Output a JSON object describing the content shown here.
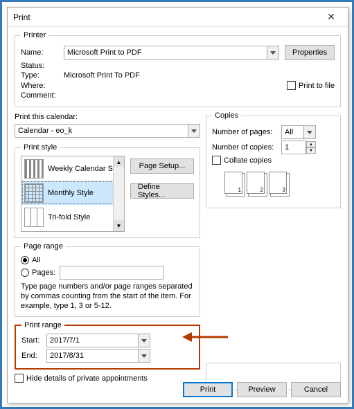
{
  "window": {
    "title": "Print",
    "close": "✕"
  },
  "printer": {
    "legend": "Printer",
    "name_label": "Name:",
    "name_value": "Microsoft Print to PDF",
    "properties_btn": "Properties",
    "status_label": "Status:",
    "type_label": "Type:",
    "type_value": "Microsoft Print To PDF",
    "where_label": "Where:",
    "comment_label": "Comment:",
    "print_to_file": "Print to file"
  },
  "calendar_section": {
    "label": "Print this calendar:",
    "value": "Calendar - eo_k"
  },
  "copies": {
    "legend": "Copies",
    "pages_label": "Number of pages:",
    "pages_value": "All",
    "copies_label": "Number of copies:",
    "copies_value": "1",
    "collate": "Collate copies",
    "page_nums": [
      "1",
      "2",
      "3"
    ]
  },
  "print_style": {
    "legend": "Print style",
    "items": [
      "Weekly Calendar S",
      "Monthly Style",
      "Tri-fold Style"
    ],
    "page_setup_btn": "Page Setup...",
    "define_styles_btn": "Define Styles..."
  },
  "page_range": {
    "legend": "Page range",
    "all": "All",
    "pages_label": "Pages:",
    "hint": "Type page numbers and/or page ranges separated by commas counting from the start of the item.  For example, type 1, 3 or 5-12."
  },
  "print_range": {
    "legend": "Print range",
    "start_label": "Start:",
    "start_value": "2017/7/1",
    "end_label": "End:",
    "end_value": "2017/8/31",
    "hide_private": "Hide details of private appointments"
  },
  "footer": {
    "print": "Print",
    "preview": "Preview",
    "cancel": "Cancel"
  }
}
